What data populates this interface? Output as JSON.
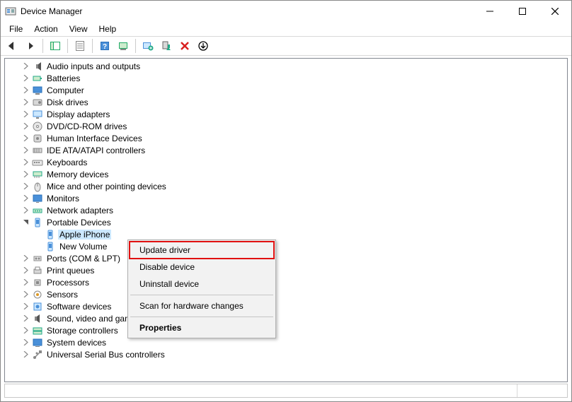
{
  "window": {
    "title": "Device Manager"
  },
  "menus": {
    "file": "File",
    "action": "Action",
    "view": "View",
    "help": "Help"
  },
  "tree": {
    "items": [
      {
        "label": "Audio inputs and outputs",
        "expanded": false,
        "level": 0,
        "icon": "speaker"
      },
      {
        "label": "Batteries",
        "expanded": false,
        "level": 0,
        "icon": "battery"
      },
      {
        "label": "Computer",
        "expanded": false,
        "level": 0,
        "icon": "computer"
      },
      {
        "label": "Disk drives",
        "expanded": false,
        "level": 0,
        "icon": "disk"
      },
      {
        "label": "Display adapters",
        "expanded": false,
        "level": 0,
        "icon": "display"
      },
      {
        "label": "DVD/CD-ROM drives",
        "expanded": false,
        "level": 0,
        "icon": "cd"
      },
      {
        "label": "Human Interface Devices",
        "expanded": false,
        "level": 0,
        "icon": "hid"
      },
      {
        "label": "IDE ATA/ATAPI controllers",
        "expanded": false,
        "level": 0,
        "icon": "ide"
      },
      {
        "label": "Keyboards",
        "expanded": false,
        "level": 0,
        "icon": "keyboard"
      },
      {
        "label": "Memory devices",
        "expanded": false,
        "level": 0,
        "icon": "memory"
      },
      {
        "label": "Mice and other pointing devices",
        "expanded": false,
        "level": 0,
        "icon": "mouse"
      },
      {
        "label": "Monitors",
        "expanded": false,
        "level": 0,
        "icon": "monitor"
      },
      {
        "label": "Network adapters",
        "expanded": false,
        "level": 0,
        "icon": "network"
      },
      {
        "label": "Portable Devices",
        "expanded": true,
        "level": 0,
        "icon": "portable"
      },
      {
        "label": "Apple iPhone",
        "expanded": null,
        "level": 1,
        "icon": "phone",
        "selected": true
      },
      {
        "label": "New Volume",
        "expanded": null,
        "level": 1,
        "icon": "phone"
      },
      {
        "label": "Ports (COM & LPT)",
        "expanded": false,
        "level": 0,
        "icon": "port",
        "truncated": "Ports (COM & LP"
      },
      {
        "label": "Print queues",
        "expanded": false,
        "level": 0,
        "icon": "printer"
      },
      {
        "label": "Processors",
        "expanded": false,
        "level": 0,
        "icon": "cpu"
      },
      {
        "label": "Sensors",
        "expanded": false,
        "level": 0,
        "icon": "sensor"
      },
      {
        "label": "Software devices",
        "expanded": false,
        "level": 0,
        "icon": "software"
      },
      {
        "label": "Sound, video and game controllers",
        "expanded": false,
        "level": 0,
        "icon": "sound",
        "truncated": "Sound, video an"
      },
      {
        "label": "Storage controllers",
        "expanded": false,
        "level": 0,
        "icon": "storage"
      },
      {
        "label": "System devices",
        "expanded": false,
        "level": 0,
        "icon": "system"
      },
      {
        "label": "Universal Serial Bus controllers",
        "expanded": false,
        "level": 0,
        "icon": "usb"
      }
    ]
  },
  "contextmenu": {
    "items": [
      {
        "label": "Update driver",
        "highlighted": true
      },
      {
        "label": "Disable device"
      },
      {
        "label": "Uninstall device"
      },
      {
        "sep": true
      },
      {
        "label": "Scan for hardware changes"
      },
      {
        "sep": true
      },
      {
        "label": "Properties",
        "bold": true
      }
    ]
  }
}
